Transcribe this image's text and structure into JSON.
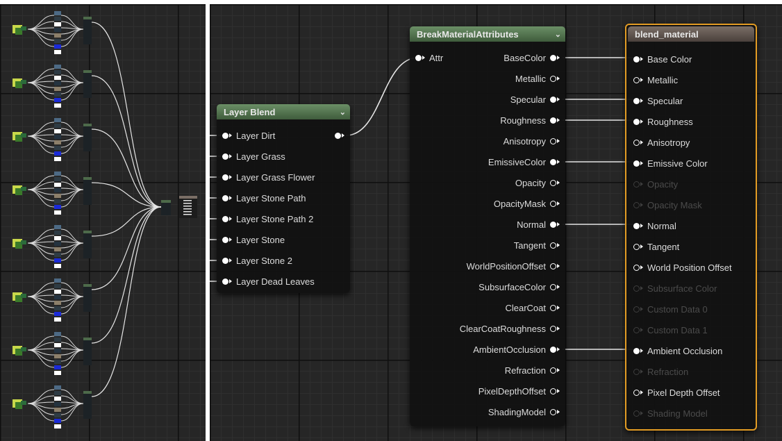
{
  "layer_blend": {
    "title": "Layer Blend",
    "output_pin": "",
    "inputs": [
      "Layer Dirt",
      "Layer Grass",
      "Layer Grass Flower",
      "Layer Stone Path",
      "Layer Stone Path 2",
      "Layer Stone",
      "Layer Stone 2",
      "Layer Dead Leaves"
    ]
  },
  "break_material_attributes": {
    "title": "BreakMaterialAttributes",
    "input": "Attr",
    "outputs": [
      {
        "label": "BaseColor",
        "style": "filled"
      },
      {
        "label": "Metallic",
        "style": "hollow"
      },
      {
        "label": "Specular",
        "style": "filled"
      },
      {
        "label": "Roughness",
        "style": "filled"
      },
      {
        "label": "Anisotropy",
        "style": "hollow"
      },
      {
        "label": "EmissiveColor",
        "style": "filled"
      },
      {
        "label": "Opacity",
        "style": "hollow"
      },
      {
        "label": "OpacityMask",
        "style": "hollow"
      },
      {
        "label": "Normal",
        "style": "filled"
      },
      {
        "label": "Tangent",
        "style": "hollow"
      },
      {
        "label": "WorldPositionOffset",
        "style": "hollow"
      },
      {
        "label": "SubsurfaceColor",
        "style": "hollow"
      },
      {
        "label": "ClearCoat",
        "style": "hollow"
      },
      {
        "label": "ClearCoatRoughness",
        "style": "hollow"
      },
      {
        "label": "AmbientOcclusion",
        "style": "filled"
      },
      {
        "label": "Refraction",
        "style": "hollow"
      },
      {
        "label": "PixelDepthOffset",
        "style": "hollow"
      },
      {
        "label": "ShadingModel",
        "style": "hollow"
      }
    ]
  },
  "blend_material": {
    "title": "blend_material",
    "inputs": [
      {
        "label": "Base Color",
        "style": "filled"
      },
      {
        "label": "Metallic",
        "style": "hollow"
      },
      {
        "label": "Specular",
        "style": "filled"
      },
      {
        "label": "Roughness",
        "style": "filled"
      },
      {
        "label": "Anisotropy",
        "style": "hollow"
      },
      {
        "label": "Emissive Color",
        "style": "filled"
      },
      {
        "label": "Opacity",
        "style": "disabled"
      },
      {
        "label": "Opacity Mask",
        "style": "disabled"
      },
      {
        "label": "Normal",
        "style": "filled"
      },
      {
        "label": "Tangent",
        "style": "hollow"
      },
      {
        "label": "World Position Offset",
        "style": "hollow"
      },
      {
        "label": "Subsurface Color",
        "style": "disabled"
      },
      {
        "label": "Custom Data 0",
        "style": "disabled"
      },
      {
        "label": "Custom Data 1",
        "style": "disabled"
      },
      {
        "label": "Ambient Occlusion",
        "style": "filled"
      },
      {
        "label": "Refraction",
        "style": "disabled"
      },
      {
        "label": "Pixel Depth Offset",
        "style": "hollow"
      },
      {
        "label": "Shading Model",
        "style": "disabled"
      }
    ]
  },
  "overview_group_count": 8,
  "colors": {
    "graph_bg": "#262626",
    "selection_outline": "#e39c24",
    "green_header": "#4f6f4b",
    "output_header": "#5e544d",
    "wire": "#e6e6e6",
    "pin_dim": "#3e3e3e"
  }
}
